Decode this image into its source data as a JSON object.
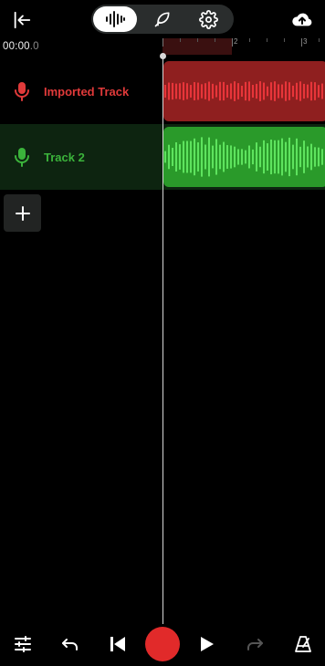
{
  "header": {
    "time_display": "00:00",
    "time_fraction": ".0"
  },
  "ruler": {
    "labels": [
      "2",
      "3"
    ]
  },
  "tracks": [
    {
      "name": "Imported Track",
      "color": "#e03a3a",
      "clip_color": "#8f1f1f",
      "wave_color": "#e8353a"
    },
    {
      "name": "Track 2",
      "color": "#3bb33b",
      "clip_color": "#2a9a2a",
      "wave_color": "#5ee35e"
    }
  ],
  "colors": {
    "record": "#e12a2a",
    "background": "#000000"
  },
  "icons": {
    "exit": "exit-icon",
    "waveform_tab": "waveform-icon",
    "effects_tab": "feather-icon",
    "settings_tab": "gear-icon",
    "upload": "cloud-upload-icon",
    "mixer": "sliders-icon",
    "undo": "undo-icon",
    "skip_start": "skip-back-icon",
    "record": "record-icon",
    "play": "play-icon",
    "redo": "redo-icon",
    "metronome": "metronome-icon",
    "add_track": "plus-icon",
    "mic": "microphone-icon"
  }
}
